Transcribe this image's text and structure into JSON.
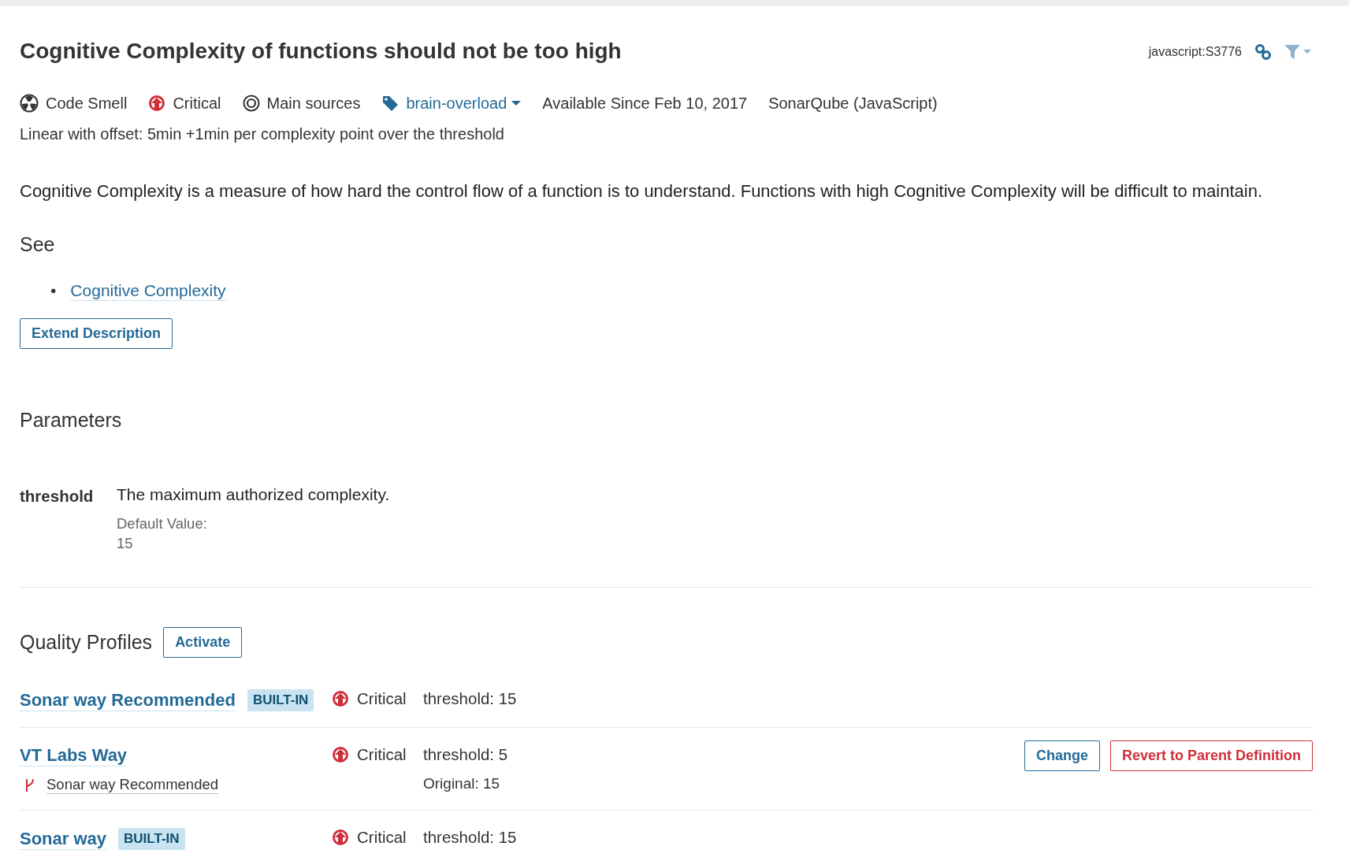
{
  "header": {
    "title": "Cognitive Complexity of functions should not be too high",
    "rule_key": "javascript:S3776"
  },
  "meta": {
    "type": "Code Smell",
    "severity": "Critical",
    "scope": "Main sources",
    "tag": "brain-overload",
    "available": "Available Since Feb 10, 2017",
    "repository": "SonarQube (JavaScript)"
  },
  "remediation": "Linear with offset: 5min +1min per complexity point over the threshold",
  "description": "Cognitive Complexity is a measure of how hard the control flow of a function is to understand. Functions with high Cognitive Complexity will be difficult to maintain.",
  "see": {
    "heading": "See",
    "links": [
      {
        "bullet": "•",
        "label": "Cognitive Complexity"
      }
    ]
  },
  "extend_button": "Extend Description",
  "parameters": {
    "heading": "Parameters",
    "items": [
      {
        "key": "threshold",
        "description": "The maximum authorized complexity.",
        "default_label": "Default Value:",
        "default_value": "15"
      }
    ]
  },
  "quality_profiles": {
    "heading": "Quality Profiles",
    "activate_button": "Activate",
    "profiles": [
      {
        "name": "Sonar way Recommended",
        "badge": "BUILT-IN",
        "severity": "Critical",
        "param": "threshold: 15"
      },
      {
        "name": "VT Labs Way",
        "parent": "Sonar way Recommended",
        "severity": "Critical",
        "param": "threshold: 5",
        "original": "Original: 15",
        "actions": [
          {
            "label": "Change",
            "kind": "primary"
          },
          {
            "label": "Revert to Parent Definition",
            "kind": "danger"
          }
        ]
      },
      {
        "name": "Sonar way",
        "badge": "BUILT-IN",
        "severity": "Critical",
        "param": "threshold: 15"
      }
    ]
  }
}
